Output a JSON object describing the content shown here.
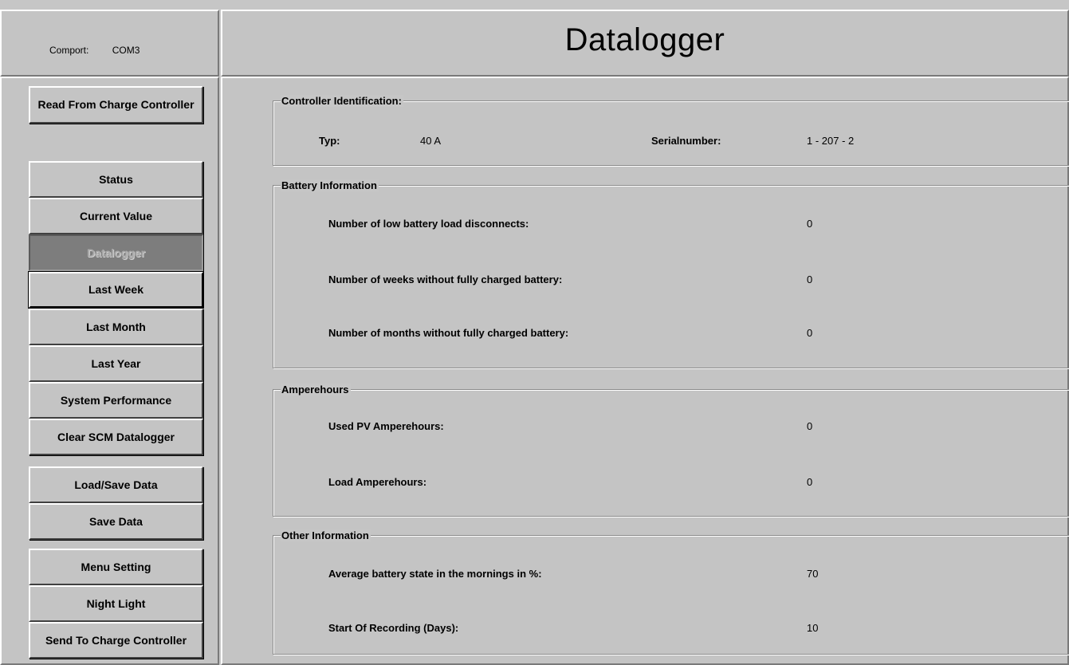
{
  "comport": {
    "label": "Comport:",
    "value": "COM3"
  },
  "title": "Datalogger",
  "sidebar": {
    "read_button": "Read From Charge Controller",
    "status": "Status",
    "current_value": "Current Value",
    "datalogger": "Datalogger",
    "last_week": "Last Week",
    "last_month": "Last Month",
    "last_year": "Last Year",
    "system_performance": "System Performance",
    "clear_datalogger": "Clear SCM Datalogger",
    "load_save_data": "Load/Save Data",
    "save_data": "Save Data",
    "menu_setting": "Menu Setting",
    "night_light": "Night Light",
    "send_button": "Send To Charge Controller"
  },
  "controller_identification": {
    "title": "Controller Identification:",
    "typ_label": "Typ:",
    "typ_value": "40 A",
    "serial_label": "Serialnumber:",
    "serial_value": "1 - 207 - 2"
  },
  "battery_information": {
    "title": "Battery Information",
    "low_battery_label": "Number of low battery load disconnects:",
    "low_battery_value": "0",
    "weeks_label": "Number of weeks without fully charged battery:",
    "weeks_value": "0",
    "months_label": "Number of months without fully charged battery:",
    "months_value": "0"
  },
  "amperehours": {
    "title": "Amperehours",
    "used_pv_label": "Used PV Amperehours:",
    "used_pv_value": "0",
    "load_label": "Load Amperehours:",
    "load_value": "0"
  },
  "other_information": {
    "title": "Other Information",
    "avg_state_label": "Average battery state in the mornings in %:",
    "avg_state_value": "70",
    "start_label": "Start Of Recording (Days):",
    "start_value": "10"
  }
}
